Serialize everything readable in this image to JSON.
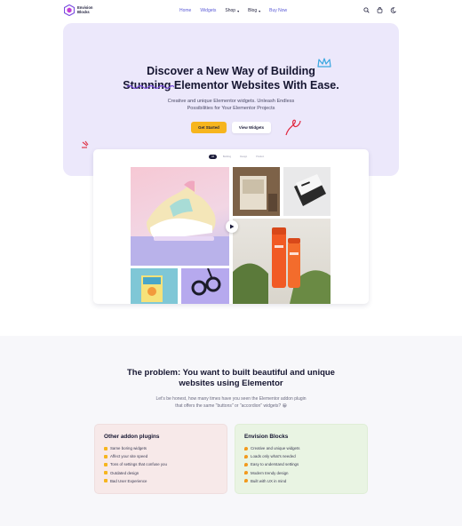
{
  "brand": {
    "name_line1": "Envision",
    "name_line2": "Blocks",
    "color": "#7b4fe0"
  },
  "nav": {
    "items": [
      {
        "label": "Home",
        "caret": false
      },
      {
        "label": "Widgets",
        "caret": false
      },
      {
        "label": "Shop",
        "caret": true
      },
      {
        "label": "Blog",
        "caret": true
      },
      {
        "label": "Buy Now",
        "caret": false
      }
    ],
    "icons": [
      "search-icon",
      "bag-icon",
      "moon-icon"
    ]
  },
  "hero": {
    "title_line1": "Discover a New Way of Building",
    "title_line2": "Stunning Elementor Websites With Ease.",
    "subtitle_line1": "Creative and unique Elementor widgets. Unleash Endless",
    "subtitle_line2": "Possibilities for Your Elementor Projects",
    "primary_button": "Get Started",
    "secondary_button": "View Widgets",
    "bg_color": "#ece8fb",
    "accent_color": "#f6b51e"
  },
  "preview": {
    "filters": [
      "All",
      "Building",
      "Design",
      "Product"
    ]
  },
  "problem": {
    "title_line1": "The problem: You want to built beautiful and unique",
    "title_line2": "websites using Elementor",
    "text_line1": "Let's be honest, how many times have you seen the Elementor addon plugin",
    "text_line2": "that offers the same \"buttons\" or \"accordion\" widgets? 😀"
  },
  "comparison": {
    "other": {
      "title": "Other addon plugins",
      "items": [
        "Same boring widgets",
        "Affect your site speed",
        "Tons of settings that confuse you",
        "Outdated design",
        "Bad User Experience"
      ]
    },
    "envision": {
      "title": "Envision Blocks",
      "items": [
        "Creative and unique widgets",
        "Loads only what's needed",
        "Easy to understand settings",
        "Modern trendy design",
        "Built with UX in mind"
      ]
    }
  }
}
